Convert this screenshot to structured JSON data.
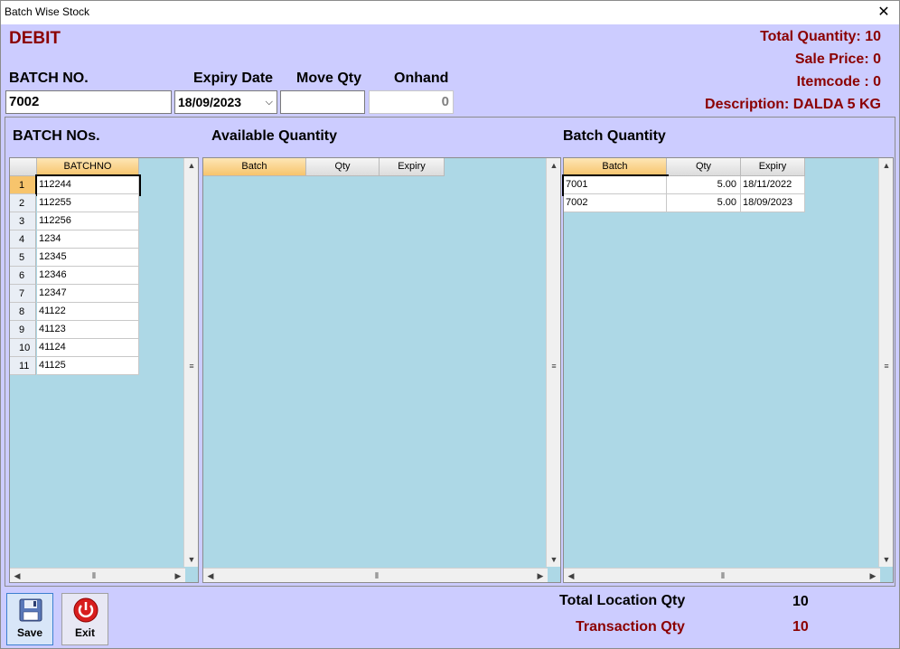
{
  "window": {
    "title": "Batch Wise Stock"
  },
  "header": {
    "mode": "DEBIT",
    "total_quantity": "Total Quantity: 10",
    "sale_price": "Sale Price: 0",
    "itemcode": "Itemcode : 0",
    "description": "Description: DALDA 5 KG"
  },
  "form": {
    "batch_label": "BATCH NO.",
    "batch_value": "7002",
    "expiry_label": "Expiry Date",
    "expiry_value": "18/09/2023",
    "moveqty_label": "Move Qty",
    "moveqty_value": "",
    "onhand_label": "Onhand",
    "onhand_value": "0"
  },
  "batch_nos": {
    "title": "BATCH NOs.",
    "column": "BATCHNO",
    "rows": [
      {
        "n": "1",
        "v": "112244"
      },
      {
        "n": "2",
        "v": "112255"
      },
      {
        "n": "3",
        "v": "112256"
      },
      {
        "n": "4",
        "v": "1234"
      },
      {
        "n": "5",
        "v": "12345"
      },
      {
        "n": "6",
        "v": "12346"
      },
      {
        "n": "7",
        "v": "12347"
      },
      {
        "n": "8",
        "v": "41122"
      },
      {
        "n": "9",
        "v": "41123"
      },
      {
        "n": "10",
        "v": "41124"
      },
      {
        "n": "11",
        "v": "41125"
      }
    ]
  },
  "available": {
    "title": "Available Quantity",
    "columns": [
      "Batch",
      "Qty",
      "Expiry"
    ]
  },
  "batch_qty": {
    "title": "Batch Quantity",
    "columns": [
      "Batch",
      "Qty",
      "Expiry"
    ],
    "rows": [
      {
        "batch": "7001",
        "qty": "5.00",
        "expiry": "18/11/2022"
      },
      {
        "batch": "7002",
        "qty": "5.00",
        "expiry": "18/09/2023"
      }
    ]
  },
  "footer": {
    "total_location_label": "Total Location Qty",
    "total_location_value": "10",
    "transaction_label": "Transaction Qty",
    "transaction_value": "10",
    "save_label": "Save",
    "exit_label": "Exit"
  },
  "colors": {
    "background": "#ccccff",
    "grid_bg": "#add8e6",
    "accent_red": "#8b0000",
    "header_orange": "#f7c46c"
  }
}
